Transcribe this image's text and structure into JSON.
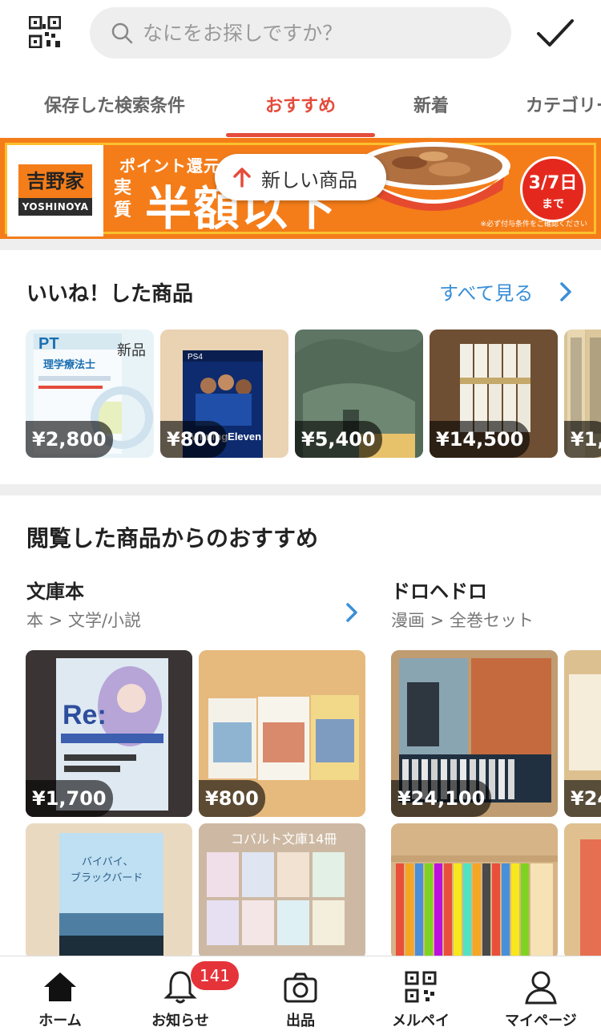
{
  "search": {
    "placeholder": "なにをお探しですか？"
  },
  "tabs": [
    {
      "label": "保存した検索条件",
      "active": false
    },
    {
      "label": "おすすめ",
      "active": true
    },
    {
      "label": "新着",
      "active": false
    },
    {
      "label": "カテゴリー",
      "active": false
    }
  ],
  "banner": {
    "logo_jp": "吉野家",
    "logo_en": "YOSHINOYA",
    "small_text": "ポイント還元",
    "side_text": "実質",
    "big_text": "半額以下",
    "date": "3/7日",
    "date_suffix": "まで",
    "note": "※必ず付与条件をご確認ください"
  },
  "new_items_pill": "新しい商品",
  "liked": {
    "title": "いいね！した商品",
    "see_all": "すべて見る",
    "items": [
      {
        "price": "¥2,800",
        "badge": "新品",
        "image": "pt-textbook"
      },
      {
        "price": "¥800",
        "image": "ps4-winning-eleven"
      },
      {
        "price": "¥5,400",
        "image": "green-bag"
      },
      {
        "price": "¥14,500",
        "image": "manga-set"
      },
      {
        "price": "¥1,",
        "image": "manga-spines"
      }
    ]
  },
  "recommend": {
    "title": "閲覧した商品からのおすすめ",
    "groups": [
      {
        "name": "文庫本",
        "category": "本 > 文学/小説",
        "items": [
          {
            "price": "¥1,700",
            "image": "rezero-novel"
          },
          {
            "price": "¥800",
            "image": "chemistry-novels"
          },
          {
            "price": "",
            "image": "bye-bye-blackbird"
          },
          {
            "price": "",
            "image": "cobalt-books",
            "caption": "コバルト文庫14冊"
          }
        ]
      },
      {
        "name": "ドロヘドロ",
        "category": "漫画 > 全巻セット",
        "items": [
          {
            "price": "¥24,100",
            "image": "dorohedoro-set"
          },
          {
            "price": "¥24",
            "image": "dorohedoro-side"
          },
          {
            "price": "",
            "image": "dorohedoro-shelf"
          },
          {
            "price": "",
            "image": "dorohedoro-side2"
          }
        ]
      }
    ]
  },
  "bottom_nav": {
    "items": [
      {
        "label": "ホーム",
        "icon": "home-icon"
      },
      {
        "label": "お知らせ",
        "icon": "bell-icon"
      },
      {
        "label": "出品",
        "icon": "camera-icon"
      },
      {
        "label": "メルペイ",
        "icon": "qr-code-icon"
      },
      {
        "label": "マイページ",
        "icon": "person-icon"
      }
    ],
    "notification_count": "141"
  },
  "colors": {
    "accent": "#e44c3c",
    "link": "#3a8fd8",
    "banner": "#f47d1a"
  }
}
